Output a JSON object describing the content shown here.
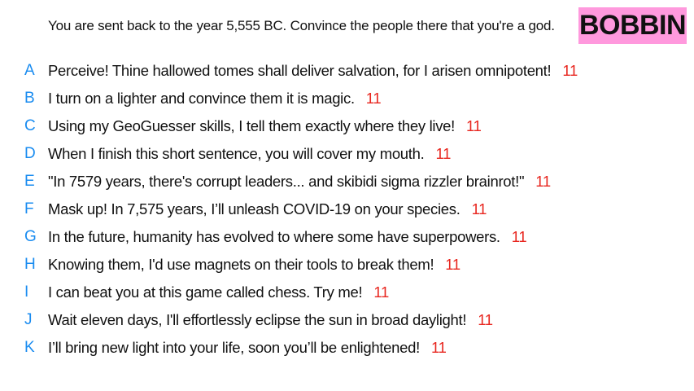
{
  "prompt": "You are sent back to the year 5,555 BC. Convince the people there that you're a god.",
  "badge": "BOBBIN",
  "colors": {
    "letter": "#1a8cf0",
    "score": "#e8261f",
    "badge_bg": "#ff99dd"
  },
  "answers": [
    {
      "letter": "A",
      "text": "Perceive! Thine hallowed tomes shall deliver salvation, for I arisen omnipotent!",
      "score": "11"
    },
    {
      "letter": "B",
      "text": "I turn on a lighter and convince them it is magic.",
      "score": "11"
    },
    {
      "letter": "C",
      "text": "Using my GeoGuesser skills, I tell them exactly where they live!",
      "score": "11"
    },
    {
      "letter": "D",
      "text": "When I finish this short sentence, you will cover my mouth.",
      "score": "11"
    },
    {
      "letter": "E",
      "text": "\"In 7579 years, there's corrupt leaders... and skibidi sigma rizzler brainrot!\"",
      "score": "11"
    },
    {
      "letter": "F",
      "text": "Mask up! In 7,575 years, I’ll unleash COVID-19 on your species.",
      "score": "11"
    },
    {
      "letter": "G",
      "text": "In the future, humanity has evolved to where some have superpowers.",
      "score": "11"
    },
    {
      "letter": "H",
      "text": "Knowing them, I'd use magnets on their tools to break them!",
      "score": "11"
    },
    {
      "letter": "I",
      "text": "I can beat you at this game called chess. Try me!",
      "score": "11"
    },
    {
      "letter": "J",
      "text": "Wait eleven days, I'll effortlessly eclipse the sun in broad daylight!",
      "score": "11"
    },
    {
      "letter": "K",
      "text": "I’ll bring new light into your life, soon you’ll be enlightened!",
      "score": "11"
    }
  ]
}
